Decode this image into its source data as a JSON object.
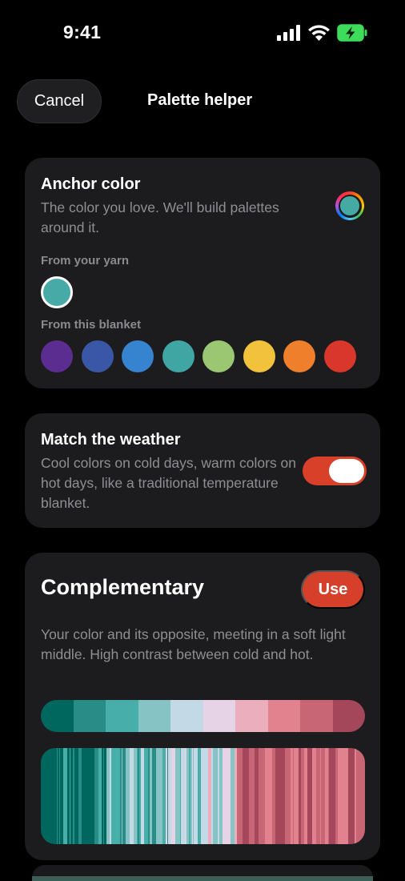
{
  "status": {
    "time": "9:41"
  },
  "header": {
    "cancel_label": "Cancel",
    "title": "Palette helper"
  },
  "anchor": {
    "title": "Anchor color",
    "description": "The color you love. We'll build palettes around it.",
    "from_yarn_label": "From your yarn",
    "yarn_color": "#48aaa6",
    "from_blanket_label": "From this blanket",
    "blanket_colors": [
      "#5b2d91",
      "#3a56a6",
      "#3683cf",
      "#3fa6a4",
      "#9bc772",
      "#f2c23c",
      "#ef7f2a",
      "#d9362c"
    ]
  },
  "weather": {
    "title": "Match the weather",
    "description": "Cool colors on cold days, warm colors on hot days, like a traditional temperature blanket.",
    "toggle_on": true
  },
  "complementary": {
    "title": "Complementary",
    "use_label": "Use",
    "description": "Your color and its opposite, meeting in a soft light middle. High contrast between cold and hot.",
    "palette": [
      "#00675f",
      "#2a8c86",
      "#48aea9",
      "#86c3c4",
      "#c4d9e6",
      "#e6d3e5",
      "#ebaebd",
      "#e2828f",
      "#c96675",
      "#a5475b"
    ]
  },
  "colors": {
    "accent": "#d9402a",
    "card": "#1c1c1e",
    "background": "#000000"
  }
}
